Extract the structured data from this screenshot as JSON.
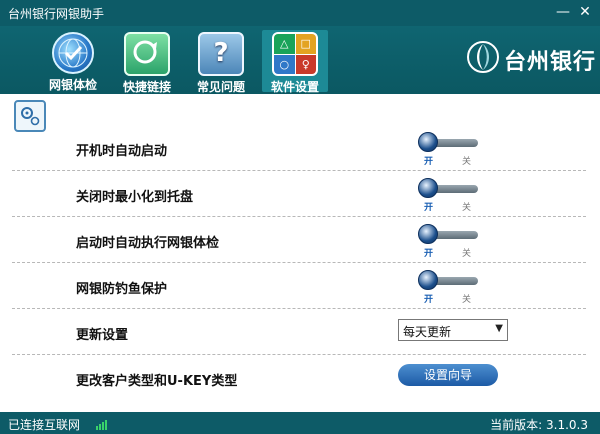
{
  "window": {
    "title": "台州银行网银助手",
    "min_label": "—",
    "close_label": "✕"
  },
  "nav": [
    {
      "label": "网银体检",
      "icon": "globe-check-icon"
    },
    {
      "label": "快捷链接",
      "icon": "link-icon"
    },
    {
      "label": "常见问题",
      "icon": "question-icon",
      "glyph": "?"
    },
    {
      "label": "软件设置",
      "icon": "settings-shapes-icon",
      "active": true
    }
  ],
  "brand": {
    "name": "台州银行"
  },
  "settings": {
    "rows": [
      {
        "label": "开机时自动启动",
        "on": "开",
        "off": "关"
      },
      {
        "label": "关闭时最小化到托盘",
        "on": "开",
        "off": "关"
      },
      {
        "label": "启动时自动执行网银体检",
        "on": "开",
        "off": "关"
      },
      {
        "label": "网银防钓鱼保护",
        "on": "开",
        "off": "关"
      }
    ],
    "update": {
      "label": "更新设置",
      "value": "每天更新"
    },
    "account": {
      "label": "更改客户类型和U-KEY类型",
      "button": "设置向导"
    }
  },
  "status": {
    "connection": "已连接互联网",
    "version": "当前版本: 3.1.0.3"
  },
  "colors": {
    "header": "#0d5b67",
    "accent": "#1c5aa5",
    "active_tab": "#1d8a96"
  }
}
